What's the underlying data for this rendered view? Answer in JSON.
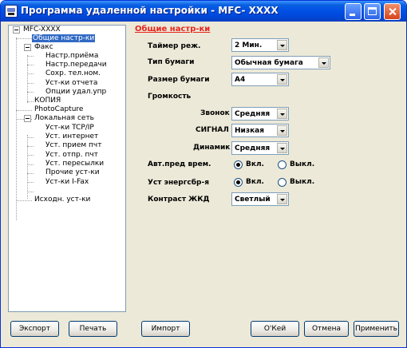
{
  "window": {
    "title": "Программа удаленной настройки - MFC- XXXX"
  },
  "tree": {
    "root": "MFC-XXXX",
    "items": [
      {
        "label": "Общие настр-ки"
      },
      {
        "label": "Факс"
      },
      {
        "label": "Настр.приёма"
      },
      {
        "label": "Настр.передачи"
      },
      {
        "label": "Сохр. тел.ном."
      },
      {
        "label": "Уст-ки отчета"
      },
      {
        "label": "Опции удал.упр"
      },
      {
        "label": "КОПИЯ"
      },
      {
        "label": "PhotoCapture"
      },
      {
        "label": "Локальная сеть"
      },
      {
        "label": "Уст-ки TCP/IP"
      },
      {
        "label": "Уст. интернет"
      },
      {
        "label": "Уст. прием пчт"
      },
      {
        "label": "Уст. отпр. пчт"
      },
      {
        "label": "Уст. пересылки"
      },
      {
        "label": "Прочие уст-ки"
      },
      {
        "label": "Уст-ки I-Fax"
      },
      {
        "label": "Исходн. уст-ки"
      }
    ]
  },
  "form": {
    "section_title": "Общие настр-ки",
    "timer_label": "Таймер реж.",
    "timer_value": "2 Мин.",
    "paper_type_label": "Тип бумаги",
    "paper_type_value": "Обычная бумага",
    "paper_size_label": "Размер бумаги",
    "paper_size_value": "A4",
    "volume_label": "Громкость",
    "ring_label": "Звонок",
    "ring_value": "Средняя",
    "beeper_label": "СИГНАЛ",
    "beeper_value": "Низкая",
    "speaker_label": "Динамик",
    "speaker_value": "Средняя",
    "auto_dst_label": "Авт.пред врем.",
    "auto_dst_on": "Вкл.",
    "auto_dst_off": "Выкл.",
    "eco_label": "Уст энергсбр-я",
    "eco_on": "Вкл.",
    "eco_off": "Выкл.",
    "lcd_label": "Контраст ЖКД",
    "lcd_value": "Светлый"
  },
  "buttons": {
    "export": "Экспорт",
    "print": "Печать",
    "import": "Импорт",
    "ok": "O'Кей",
    "cancel": "Отмена",
    "apply": "Применить"
  },
  "colors": {
    "title_bar": "#0050e5",
    "section_title": "#e8251c",
    "selection": "#316ac5"
  }
}
